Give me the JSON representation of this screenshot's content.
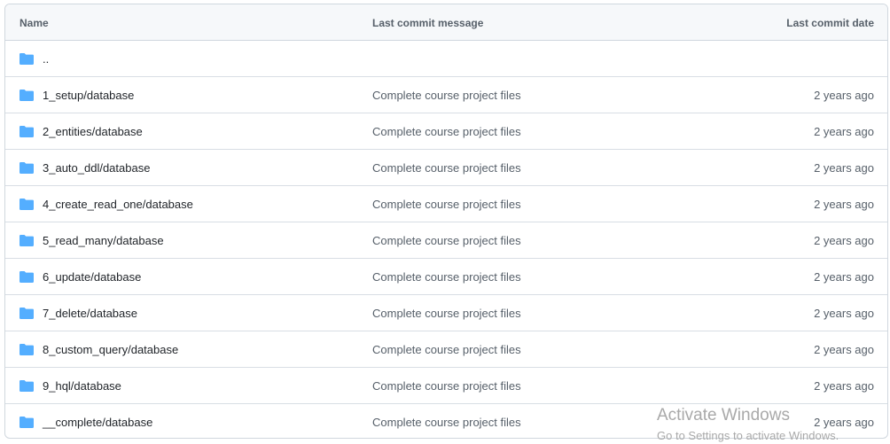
{
  "table": {
    "headers": {
      "name": "Name",
      "message": "Last commit message",
      "date": "Last commit date"
    },
    "parent_dir": "..",
    "rows": [
      {
        "name": "1_setup/database",
        "message": "Complete course project files",
        "date": "2 years ago"
      },
      {
        "name": "2_entities/database",
        "message": "Complete course project files",
        "date": "2 years ago"
      },
      {
        "name": "3_auto_ddl/database",
        "message": "Complete course project files",
        "date": "2 years ago"
      },
      {
        "name": "4_create_read_one/database",
        "message": "Complete course project files",
        "date": "2 years ago"
      },
      {
        "name": "5_read_many/database",
        "message": "Complete course project files",
        "date": "2 years ago"
      },
      {
        "name": "6_update/database",
        "message": "Complete course project files",
        "date": "2 years ago"
      },
      {
        "name": "7_delete/database",
        "message": "Complete course project files",
        "date": "2 years ago"
      },
      {
        "name": "8_custom_query/database",
        "message": "Complete course project files",
        "date": "2 years ago"
      },
      {
        "name": "9_hql/database",
        "message": "Complete course project files",
        "date": "2 years ago"
      },
      {
        "name": "__complete/database",
        "message": "Complete course project files",
        "date": "2 years ago"
      }
    ]
  },
  "icons": {
    "folder": "folder-icon"
  },
  "colors": {
    "folder": "#54aeff",
    "header_bg": "#f6f8fa",
    "border": "#d0d7de",
    "muted_text": "#57606a"
  },
  "watermark": {
    "title": "Activate Windows",
    "subtitle": "Go to Settings to activate Windows."
  }
}
